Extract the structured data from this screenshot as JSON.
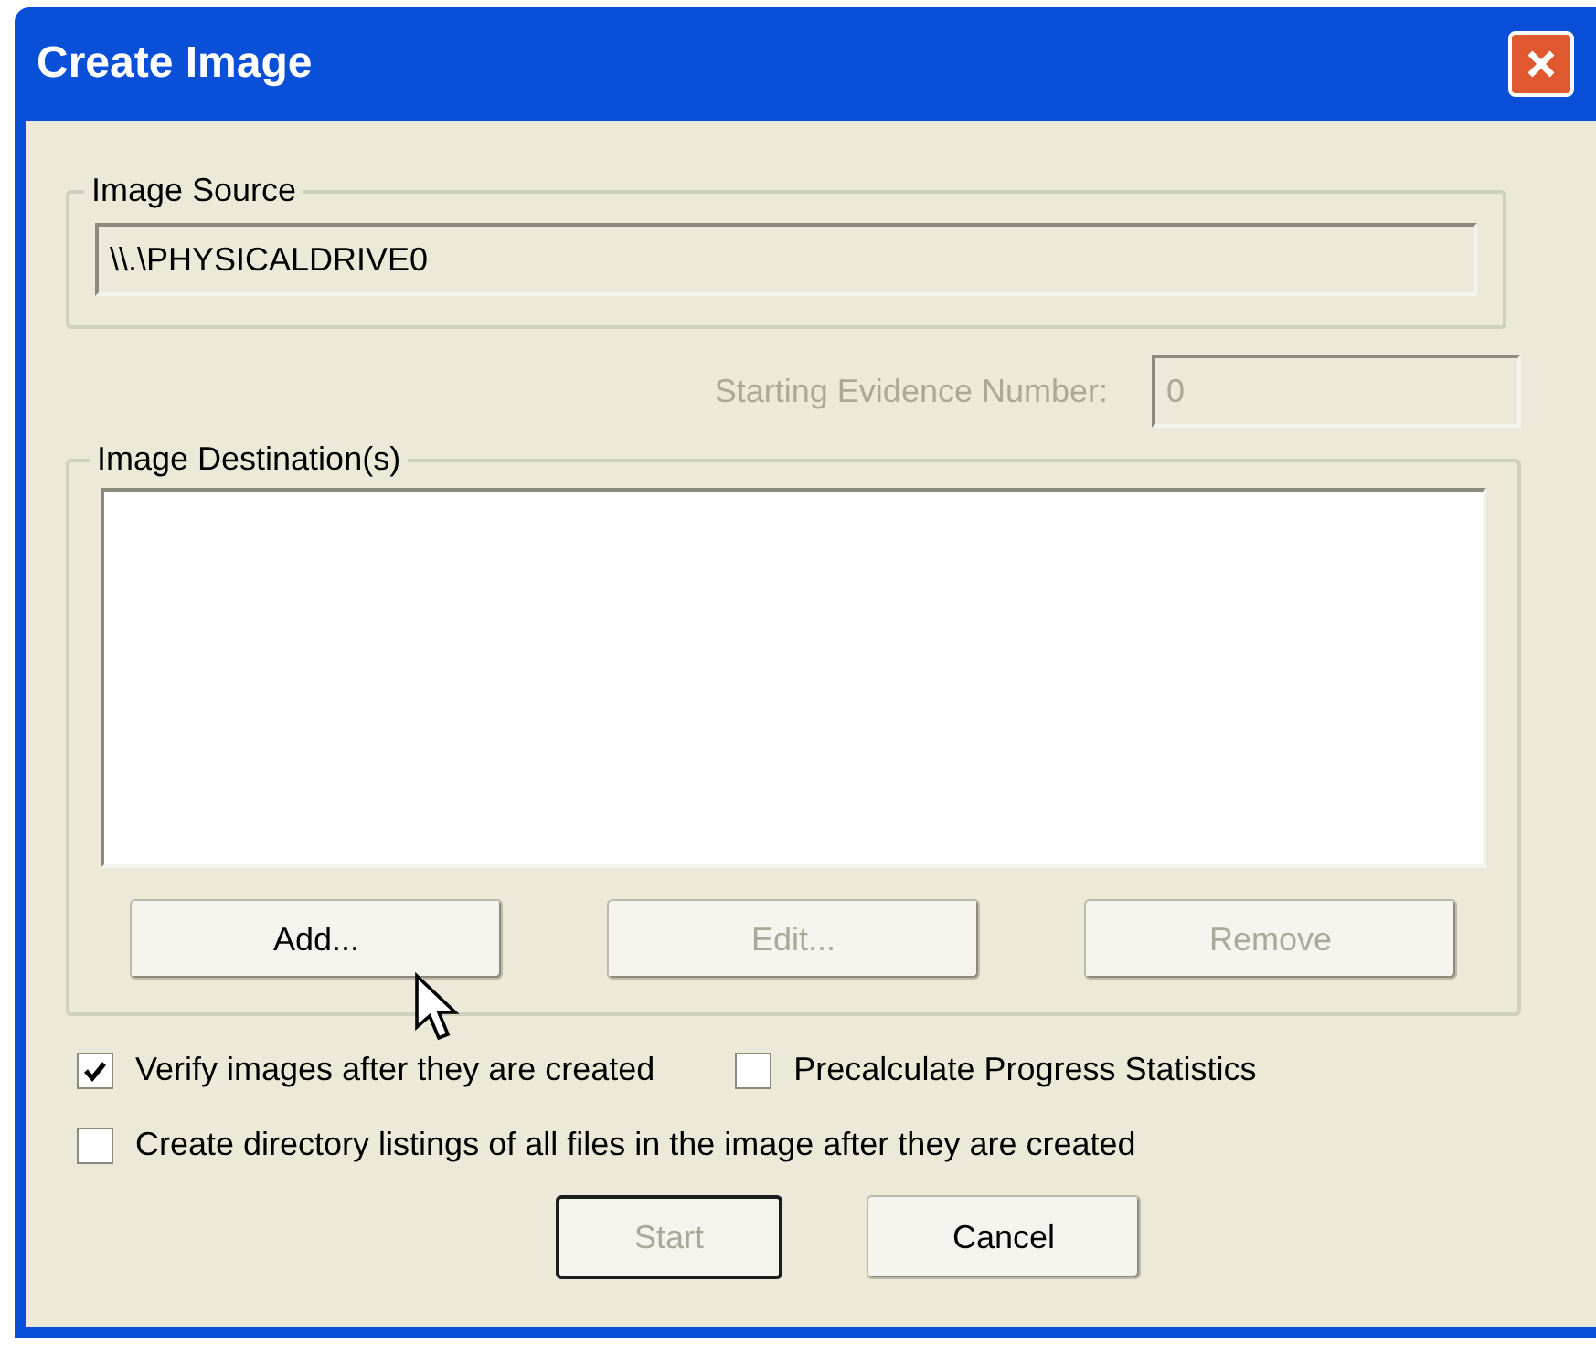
{
  "window": {
    "title": "Create Image"
  },
  "image_source": {
    "label": "Image Source",
    "value": "\\\\.\\PHYSICALDRIVE0"
  },
  "starting_evidence": {
    "label": "Starting Evidence Number:",
    "value": "0",
    "disabled": true
  },
  "image_destinations": {
    "label": "Image Destination(s)",
    "buttons": [
      {
        "label": "Add...",
        "disabled": false
      },
      {
        "label": "Edit...",
        "disabled": true
      },
      {
        "label": "Remove",
        "disabled": true
      }
    ]
  },
  "option_rows": [
    [
      {
        "label": "Verify images after they are created",
        "checked": true
      },
      {
        "label": "Precalculate Progress Statistics",
        "checked": false
      }
    ],
    [
      {
        "label": "Create directory listings of all files in the image after they are created",
        "checked": false
      }
    ]
  ],
  "buttons": [
    {
      "label": "Start",
      "disabled": true,
      "default": true
    },
    {
      "label": "Cancel",
      "disabled": false,
      "default": false
    }
  ]
}
